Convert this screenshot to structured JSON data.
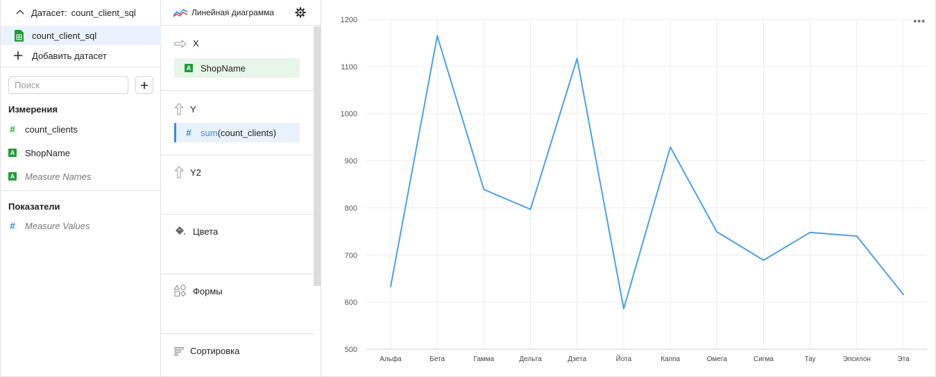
{
  "dataset": {
    "header_label": "Датасет:",
    "name": "count_client_sql",
    "item_label": "count_client_sql",
    "add_label": "Добавить датасет"
  },
  "search": {
    "placeholder": "Поиск",
    "value": ""
  },
  "dimensions": {
    "title": "Измерения",
    "items": [
      {
        "label": "count_clients",
        "type": "number"
      },
      {
        "label": "ShopName",
        "type": "string"
      },
      {
        "label": "Measure Names",
        "type": "string"
      }
    ]
  },
  "measures": {
    "title": "Показатели",
    "items": [
      {
        "label": "Measure Values",
        "type": "number"
      }
    ]
  },
  "visualization": {
    "type_label": "Линейная диаграмма",
    "sections": {
      "x": {
        "label": "X",
        "field": "ShopName"
      },
      "y": {
        "label": "Y",
        "field_fn": "sum",
        "field_arg": "(count_clients)"
      },
      "y2": {
        "label": "Y2"
      },
      "colors": {
        "label": "Цвета"
      },
      "shapes": {
        "label": "Формы"
      },
      "sort": {
        "label": "Сортировка"
      }
    }
  },
  "chart_menu_icon": "more-horizontal-icon",
  "colors": {
    "line": "#4ba0e8",
    "accent": "#3b8ae0",
    "green": "#1e9d35"
  },
  "chart_data": {
    "type": "line",
    "categories": [
      "Альфа",
      "Бета",
      "Гамма",
      "Дельта",
      "Дзета",
      "Йота",
      "Каппа",
      "Омега",
      "Сигма",
      "Тау",
      "Эпсилон",
      "Эта"
    ],
    "series": [
      {
        "values": [
          633,
          1165,
          839,
          797,
          1117,
          586,
          929,
          749,
          689,
          748,
          740,
          616
        ]
      }
    ],
    "yticks": [
      500,
      600,
      700,
      800,
      900,
      1000,
      1100,
      1200
    ],
    "ylim": [
      500,
      1200
    ],
    "grid": true,
    "legend": "none"
  }
}
